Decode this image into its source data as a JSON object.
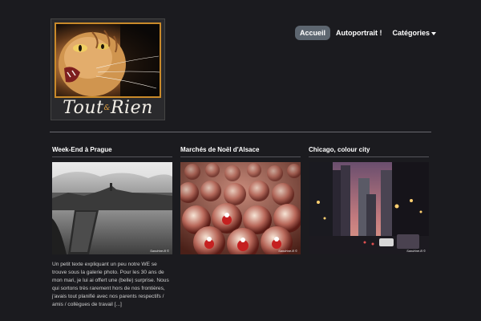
{
  "site": {
    "logo_text_left": "Tout",
    "logo_amp": "&",
    "logo_text_right": "Rien"
  },
  "nav": {
    "items": [
      {
        "label": "Accueil",
        "active": true
      },
      {
        "label": "Autoportrait !",
        "active": false
      },
      {
        "label": "Catégories",
        "active": false,
        "has_dropdown": true
      }
    ]
  },
  "posts": [
    {
      "title": "Week-End à Prague",
      "excerpt": "Un petit texte expliquant un peu notre WE se trouve sous la galerie photo.   Pour les 30 ans de mon mari, je lui ai offert une (belle) surprise. Nous qui sortons très rarement hors de nos frontières, j'avais tout planifié avec nos parents respectifs / amis / collègues de travail [...]",
      "image": "prague-black-white-panorama"
    },
    {
      "title": "Marchés de Noël d'Alsace",
      "excerpt": "",
      "image": "christmas-snow-globes"
    },
    {
      "title": "Chicago, colour city",
      "excerpt": "",
      "image": "chicago-street-dusk"
    }
  ],
  "colors": {
    "background": "#1b1b1f",
    "nav_active": "#5d6670",
    "logo_border": "#c98a2a"
  }
}
